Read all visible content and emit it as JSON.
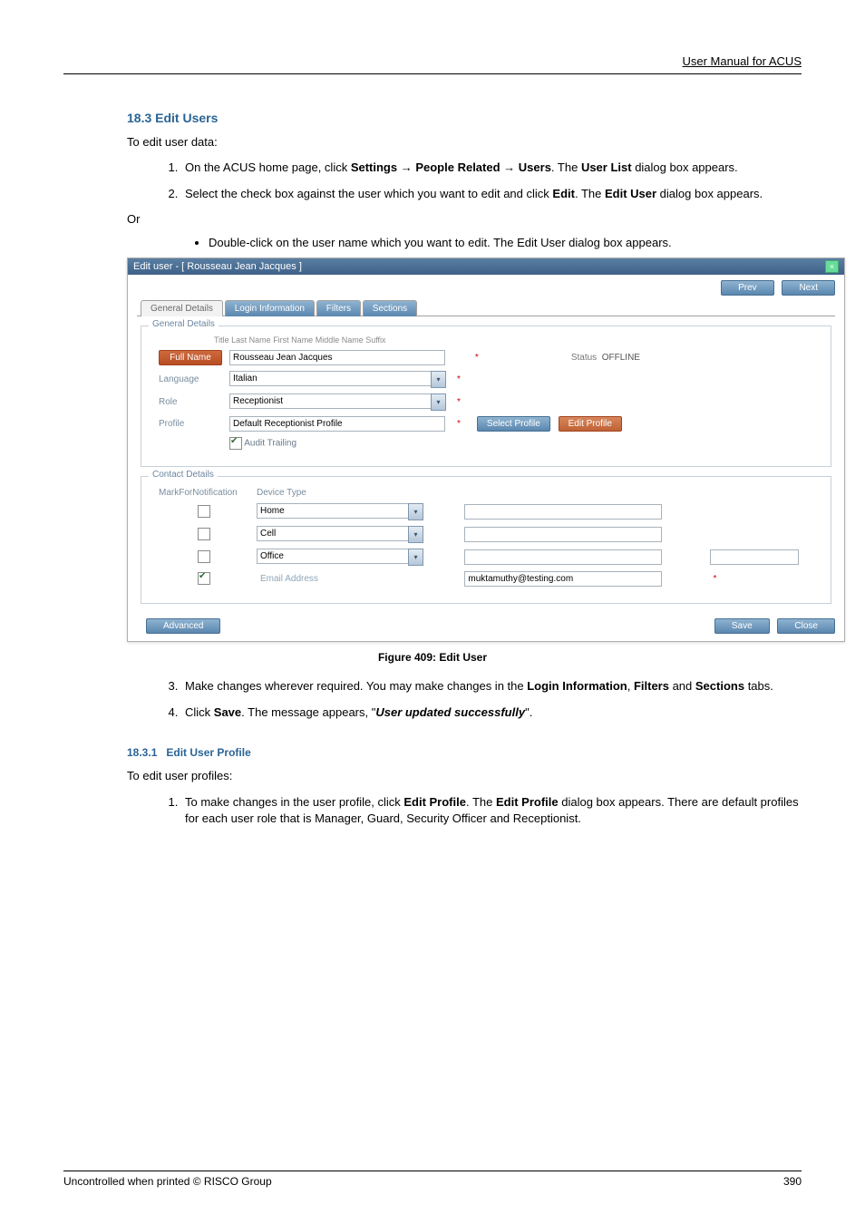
{
  "header": {
    "manual_title": "User Manual for ACUS"
  },
  "section": {
    "num": "18.3",
    "title": "Edit Users"
  },
  "intro": "To edit user data:",
  "steps_a": [
    {
      "pre": "On the ACUS home page, click ",
      "b1": "Settings",
      "mid1": " → ",
      "b2": "People Related",
      "mid2": " → ",
      "b3": "Users",
      "post1": ". The ",
      "b4": "User List",
      "post2": " dialog box appears."
    },
    {
      "pre": "Select the check box against the user which you want to edit and click ",
      "b1": "Edit",
      "post1": ". The ",
      "b2": "Edit User",
      "post2": " dialog box appears."
    }
  ],
  "or": "Or",
  "bullet": "Double-click on the user name which you want to edit. The Edit User dialog box appears.",
  "figure_caption": "Figure 409: Edit User",
  "steps_b_start": 3,
  "steps_b": [
    {
      "pre": "Make changes wherever required. You may make changes in the ",
      "b1": "Login Information",
      "mid1": ", ",
      "b2": "Filters",
      "mid2": " and ",
      "b3": "Sections",
      "post": " tabs."
    },
    {
      "pre": "Click ",
      "b1": "Save",
      "mid1": ". The message appears, \"",
      "bi": "User updated successfully",
      "post": "\"."
    }
  ],
  "sub": {
    "num": "18.3.1",
    "title": "Edit User Profile"
  },
  "sub_intro": "To edit user profiles:",
  "sub_steps": [
    {
      "pre": "To make changes in the user profile, click ",
      "b1": "Edit Profile",
      "mid1": ". The ",
      "b2": "Edit Profile",
      "post": " dialog box appears. There are default profiles for each user role that is Manager, Guard, Security Officer and Receptionist."
    }
  ],
  "footer": {
    "left": "Uncontrolled when printed © RISCO Group",
    "right": "390"
  },
  "dialog": {
    "title": "Edit user - [ Rousseau Jean Jacques ]",
    "top_buttons": {
      "prev": "Prev",
      "next": "Next"
    },
    "tabs": [
      "General Details",
      "Login Information",
      "Filters",
      "Sections"
    ],
    "general_legend": "General Details",
    "name_hint": "Title   Last Name   First Name   Middle Name   Suffix",
    "full_name_btn": "Full Name",
    "full_name": "Rousseau Jean Jacques",
    "status_label": "Status",
    "status_value": "OFFLINE",
    "rows": {
      "language_label": "Language",
      "language_value": "Italian",
      "role_label": "Role",
      "role_value": "Receptionist",
      "profile_label": "Profile",
      "profile_value": "Default Receptionist Profile",
      "select_profile_btn": "Select Profile",
      "edit_profile_btn": "Edit Profile"
    },
    "audit_label": "Audit Trailing",
    "contact_legend": "Contact Details",
    "contact_headers": {
      "mark": "MarkForNotification",
      "type": "Device Type"
    },
    "contacts": [
      {
        "type": "Home",
        "value": "",
        "checked": false
      },
      {
        "type": "Cell",
        "value": "",
        "checked": false
      },
      {
        "type": "Office",
        "value": "",
        "checked": false
      },
      {
        "type": "Email Address",
        "value": "muktamuthy@testing.com",
        "checked": true
      }
    ],
    "footer_buttons": {
      "advanced": "Advanced",
      "save": "Save",
      "close": "Close"
    }
  }
}
